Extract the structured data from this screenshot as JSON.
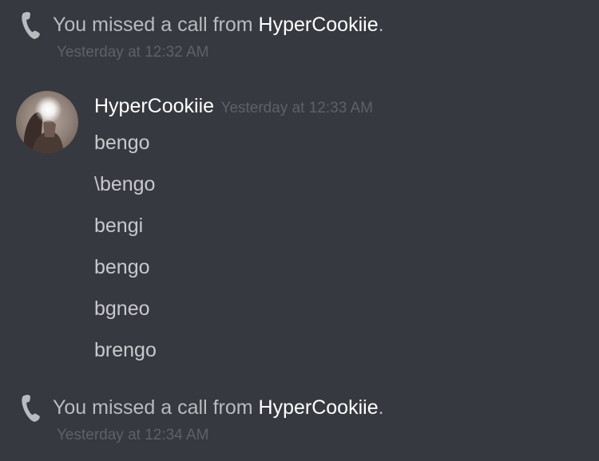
{
  "system_messages": [
    {
      "prefix": "You missed a call from ",
      "user": "HyperCookiie",
      "suffix": ".",
      "timestamp": "Yesterday at 12:32 AM",
      "icon": "phone-icon"
    },
    {
      "prefix": "You missed a call from ",
      "user": "HyperCookiie",
      "suffix": ".",
      "timestamp": "Yesterday at 12:34 AM",
      "icon": "phone-icon"
    }
  ],
  "message_group": {
    "username": "HyperCookiie",
    "timestamp": "Yesterday at 12:33 AM",
    "messages": [
      "bengo",
      "\\bengo",
      "bengi",
      "bengo",
      "bgneo",
      "brengo"
    ]
  },
  "colors": {
    "background": "#36393f",
    "username": "#ffffff",
    "timestamp": "#5e6167",
    "message_text": "#c8c9cc",
    "icon": "#b9bbbe"
  }
}
